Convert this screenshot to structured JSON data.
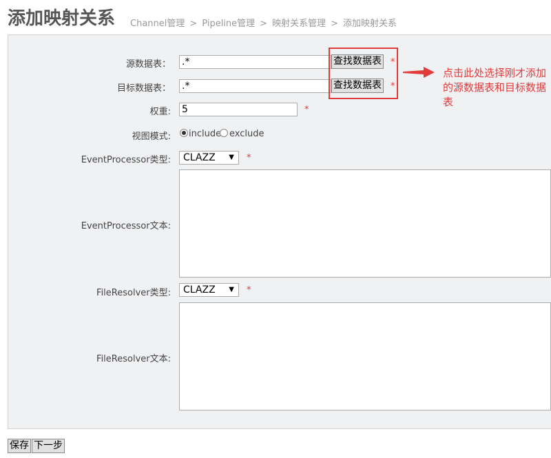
{
  "header": {
    "title": "添加映射关系",
    "breadcrumb": [
      "Channel管理",
      "Pipeline管理",
      "映射关系管理",
      "添加映射关系"
    ],
    "separator": ">"
  },
  "form": {
    "source_table": {
      "label": "源数据表：",
      "value": ".*",
      "button": "查找数据表",
      "required": "*"
    },
    "target_table": {
      "label": "目标数据表：",
      "value": ".*",
      "button": "查找数据表",
      "required": "*"
    },
    "weight": {
      "label": "权重:",
      "value": "5",
      "required": "*"
    },
    "view_mode": {
      "label": "视图模式:",
      "options": [
        "include",
        "exclude"
      ],
      "selected": "include"
    },
    "event_processor_type": {
      "label": "EventProcessor类型:",
      "value": "CLAZZ",
      "required": "*"
    },
    "event_processor_text": {
      "label": "EventProcessor文本:",
      "value": ""
    },
    "file_resolver_type": {
      "label": "FileResolver类型:",
      "value": "CLAZZ",
      "required": "*"
    },
    "file_resolver_text": {
      "label": "FileResolver文本:",
      "value": ""
    }
  },
  "annotation": {
    "text": "点击此处选择刚才添加的源数据表和目标数据表",
    "color": "#e23b3b"
  },
  "actions": {
    "save": "保存",
    "next": "下一步"
  }
}
